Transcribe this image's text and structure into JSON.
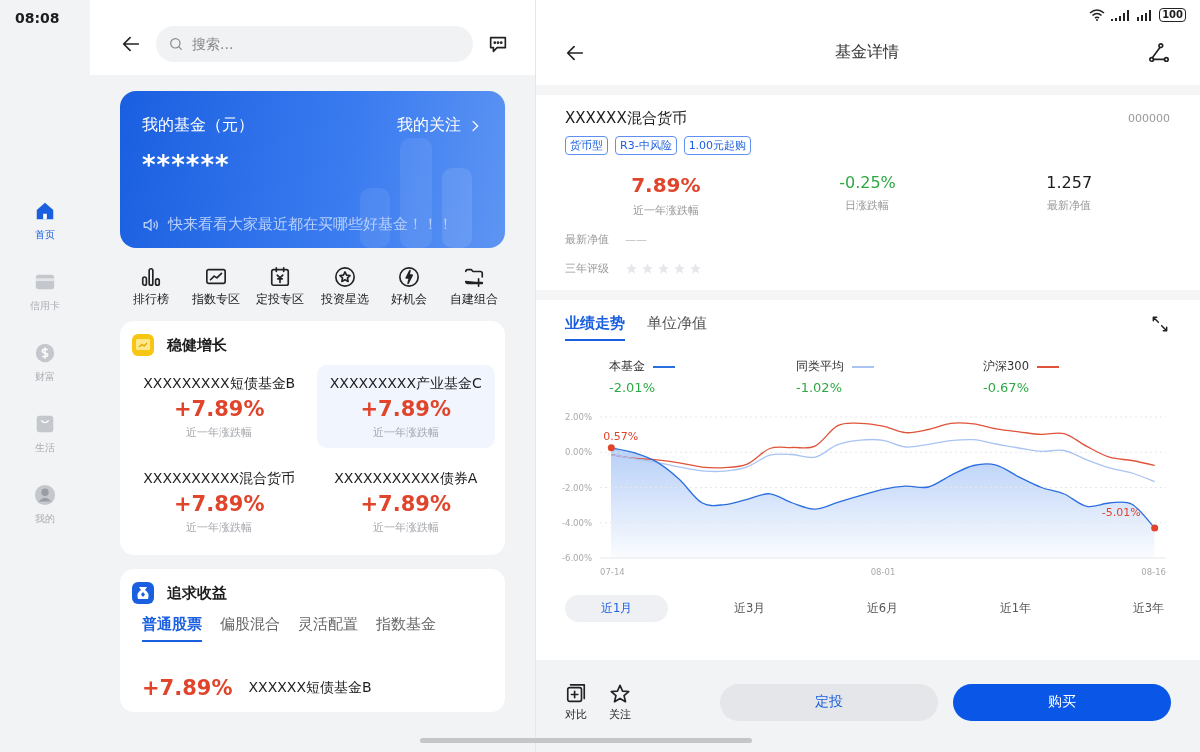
{
  "status_bar": {
    "time": "08:08",
    "battery": "100"
  },
  "sidebar": {
    "items": [
      {
        "label": "首页",
        "kind": "home",
        "selected": true
      },
      {
        "label": "信用卡",
        "kind": "card",
        "selected": false
      },
      {
        "label": "财富",
        "kind": "wealth",
        "selected": false
      },
      {
        "label": "生活",
        "kind": "life",
        "selected": false
      },
      {
        "label": "我的",
        "kind": "me",
        "selected": false
      }
    ]
  },
  "home": {
    "search": {
      "placeholder": "搜索..."
    },
    "banner": {
      "title": "我的基金（元）",
      "link": "我的关注",
      "amount": "******",
      "notice": "快来看看大家最近都在买哪些好基金！！！"
    },
    "shortcuts": [
      {
        "label": "排行榜",
        "kind": "rank"
      },
      {
        "label": "指数专区",
        "kind": "index"
      },
      {
        "label": "定投专区",
        "kind": "plan"
      },
      {
        "label": "投资星选",
        "kind": "star"
      },
      {
        "label": "好机会",
        "kind": "chance"
      },
      {
        "label": "自建组合",
        "kind": "folder"
      }
    ],
    "steady": {
      "title": "稳健增长",
      "funds": [
        {
          "name": "XXXXXXXXX短债基金B",
          "change": "+7.89%",
          "caption": "近一年涨跌幅",
          "selected": false
        },
        {
          "name": "XXXXXXXXX产业基金C",
          "change": "+7.89%",
          "caption": "近一年涨跌幅",
          "selected": true
        },
        {
          "name": "XXXXXXXXXX混合货币",
          "change": "+7.89%",
          "caption": "近一年涨跌幅",
          "selected": false
        },
        {
          "name": "XXXXXXXXXXX债券A",
          "change": "+7.89%",
          "caption": "近一年涨跌幅",
          "selected": false
        }
      ]
    },
    "growth": {
      "title": "追求收益",
      "tabs": [
        {
          "label": "普通股票",
          "selected": true
        },
        {
          "label": "偏股混合",
          "selected": false
        },
        {
          "label": "灵活配置",
          "selected": false
        },
        {
          "label": "指数基金",
          "selected": false
        }
      ],
      "rows": [
        {
          "change": "+7.89%",
          "name": "XXXXXX短债基金B"
        }
      ]
    }
  },
  "detail": {
    "title": "基金详情",
    "fund": {
      "name": "XXXXXX混合货币",
      "code": "000000",
      "tags": [
        "货币型",
        "R3-中风险",
        "1.00元起购"
      ],
      "stats": [
        {
          "value": "7.89%",
          "label": "近一年涨跌幅",
          "color": "#e0442b"
        },
        {
          "value": "-0.25%",
          "label": "日涨跌幅",
          "color": "#2ea843"
        },
        {
          "value": "1.257",
          "label": "最新净值",
          "color": "#1d1d1f"
        }
      ],
      "info": [
        {
          "label": "最新净值",
          "value": "——"
        }
      ],
      "rating": {
        "label": "三年评级",
        "stars": 0
      }
    },
    "performance": {
      "tabs": [
        {
          "label": "业绩走势",
          "selected": true
        },
        {
          "label": "单位净值",
          "selected": false
        }
      ],
      "legend": [
        {
          "value": "-2.01%"
        },
        {
          "value": "-1.02%"
        },
        {
          "value": "-0.67%"
        }
      ],
      "chart_data": {
        "type": "line",
        "grid": true,
        "categories": [
          "07-14",
          null,
          null,
          null,
          null,
          null,
          null,
          null,
          null,
          null,
          null,
          null,
          "08-01",
          null,
          null,
          null,
          null,
          null,
          null,
          null,
          null,
          null,
          null,
          null,
          "08-16"
        ],
        "series": [
          {
            "name": "本基金",
            "color": "#2b6ee0",
            "values": [
              0.25,
              -0.02,
              -0.55,
              -1.53,
              -2.87,
              -2.97,
              -2.67,
              -2.36,
              -2.88,
              -3.23,
              -2.84,
              -2.46,
              -2.1,
              -1.92,
              -1.97,
              -1.31,
              -0.75,
              -0.73,
              -1.4,
              -2.0,
              -2.37,
              -3.07,
              -2.88,
              -2.95,
              -4.3
            ]
          },
          {
            "name": "同类平均",
            "color": "#a9c3f2",
            "values": [
              -0.13,
              -0.36,
              -0.57,
              -0.83,
              -1.05,
              -1.07,
              -0.83,
              -0.17,
              -0.13,
              -0.28,
              0.43,
              0.69,
              0.68,
              0.3,
              0.45,
              0.66,
              0.71,
              0.47,
              0.24,
              0.05,
              0.1,
              -0.43,
              -0.88,
              -1.18,
              -1.67
            ]
          },
          {
            "name": "沪深300",
            "color": "#e0533a",
            "values": [
              -0.13,
              -0.34,
              -0.43,
              -0.6,
              -0.84,
              -0.87,
              -0.67,
              0.21,
              0.27,
              0.35,
              1.51,
              1.64,
              1.48,
              1.11,
              1.29,
              1.64,
              1.61,
              1.33,
              1.16,
              1.01,
              1.05,
              0.33,
              -0.28,
              -0.47,
              -0.75
            ]
          }
        ],
        "ylim": [
          -6,
          2
        ],
        "yticks": [
          {
            "value": 2,
            "label": "2.00%"
          },
          {
            "value": 0,
            "label": "0.00%"
          },
          {
            "value": -2,
            "label": "-2.00%"
          },
          {
            "value": -4,
            "label": "-4.00%"
          },
          {
            "value": -6,
            "label": "-6.00%"
          }
        ],
        "annotations": [
          "0.57%",
          "-5.01%"
        ]
      },
      "periods": [
        {
          "label": "近1月",
          "selected": true
        },
        {
          "label": "近3月",
          "selected": false
        },
        {
          "label": "近6月",
          "selected": false
        },
        {
          "label": "近1年",
          "selected": false
        },
        {
          "label": "近3年",
          "selected": false
        }
      ]
    },
    "actions": [
      {
        "label": "对比",
        "kind": "compare"
      },
      {
        "label": "关注",
        "kind": "follow"
      }
    ],
    "buttons": [
      {
        "label": "定投",
        "kind": "secondary"
      },
      {
        "label": "购买",
        "kind": "primary"
      }
    ]
  }
}
